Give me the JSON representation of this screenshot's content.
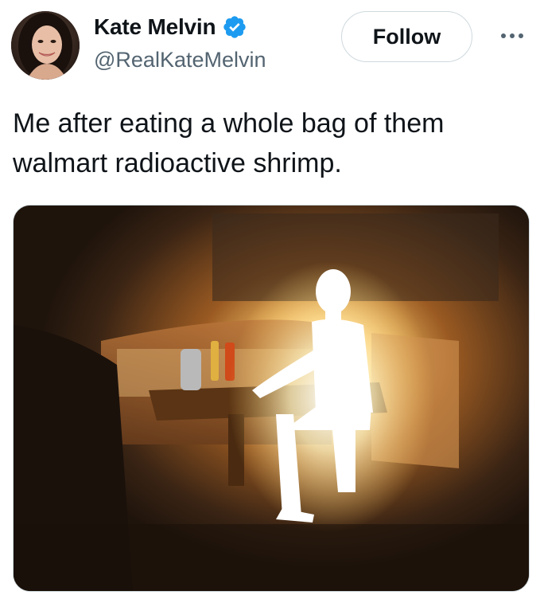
{
  "author": {
    "display_name": "Kate Melvin",
    "handle": "@RealKateMelvin",
    "verified": true,
    "verified_color": "#1d9bf0"
  },
  "actions": {
    "follow_label": "Follow",
    "more_icon": "more-horizontal-icon"
  },
  "tweet": {
    "line1": "Me after eating a whole bag of them",
    "line2": "walmart radioactive shrimp."
  },
  "media": {
    "alt": "Glowing man sitting at a restaurant booth table"
  },
  "colors": {
    "text_primary": "#0f1419",
    "text_secondary": "#536471",
    "border": "#cfd9de"
  }
}
